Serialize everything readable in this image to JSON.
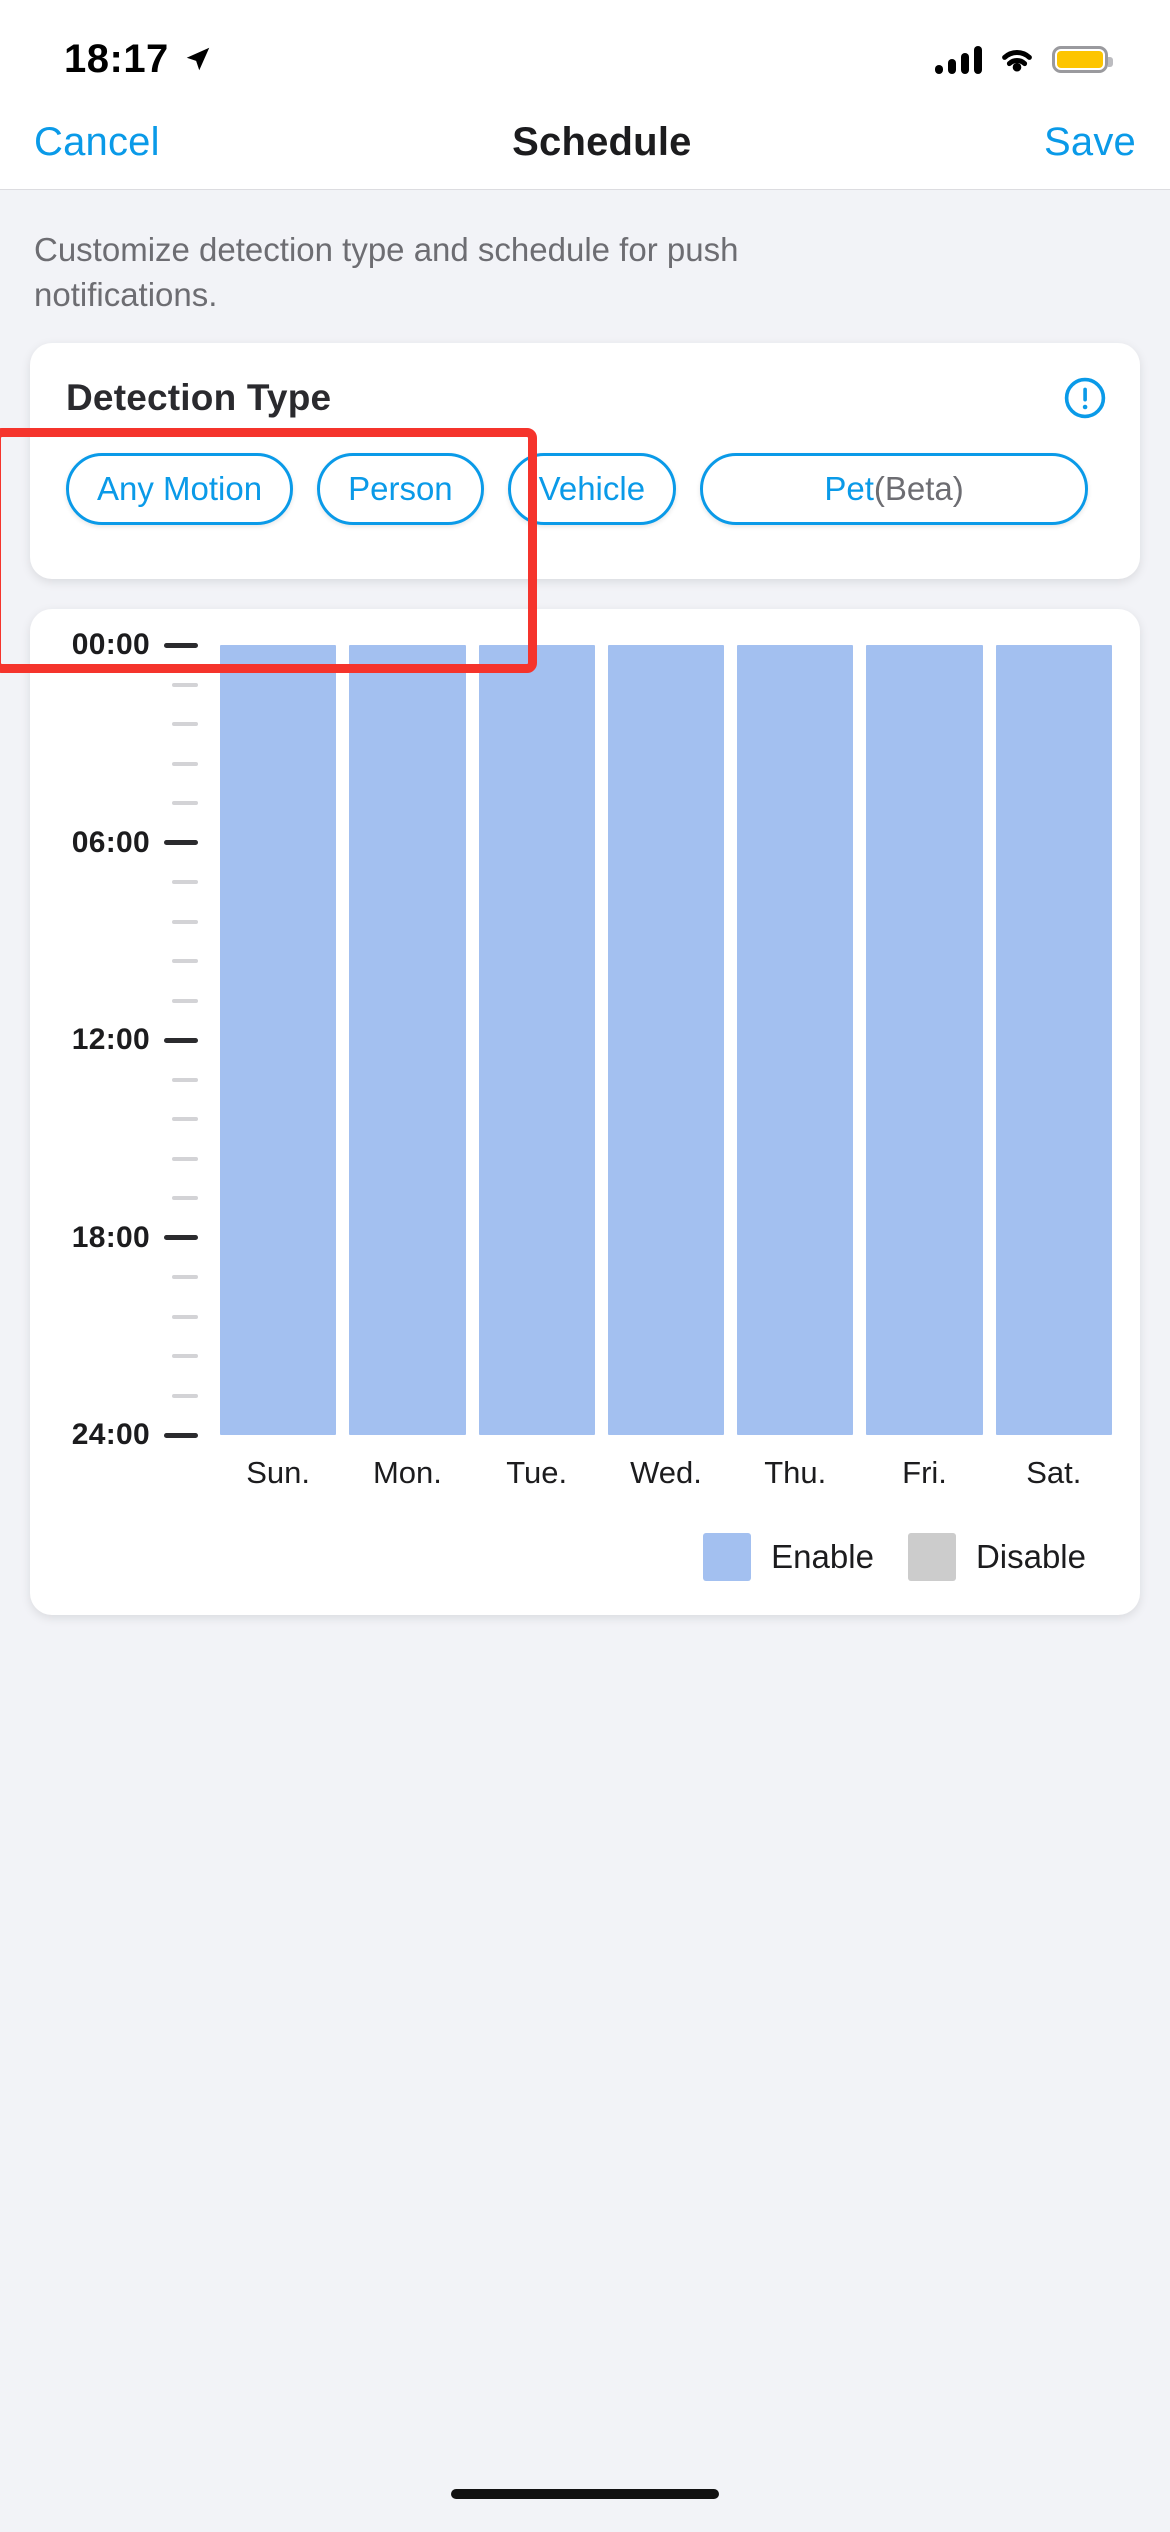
{
  "status_bar": {
    "time": "18:17",
    "location_icon": "location-arrow-icon",
    "signal_icon": "cellular-signal-icon",
    "wifi_icon": "wifi-icon",
    "battery_icon": "battery-icon",
    "battery_color": "#fdc500"
  },
  "nav": {
    "cancel_label": "Cancel",
    "title": "Schedule",
    "save_label": "Save",
    "accent_color": "#0a9ae8"
  },
  "description": "Customize detection type and schedule for push notifications.",
  "detection": {
    "title": "Detection Type",
    "info_icon": "info-exclamation-circle-icon",
    "info_color": "#0a9ae8",
    "chips": [
      {
        "label": "Any Motion",
        "suffix": ""
      },
      {
        "label": "Person",
        "suffix": ""
      },
      {
        "label": "Vehicle",
        "suffix": ""
      },
      {
        "label": "Pet",
        "suffix": "(Beta)"
      }
    ],
    "highlight_color": "#f5342c"
  },
  "chart_data": {
    "type": "bar",
    "title": "",
    "xlabel": "",
    "ylabel": "",
    "categories": [
      "Sun.",
      "Mon.",
      "Tue.",
      "Wed.",
      "Thu.",
      "Fri.",
      "Sat."
    ],
    "y_tick_labels": [
      "00:00",
      "06:00",
      "12:00",
      "18:00",
      "24:00"
    ],
    "y_tick_values": [
      0,
      6,
      12,
      18,
      24
    ],
    "ylim": [
      0,
      24
    ],
    "y_axis_inverted": true,
    "minor_ticks_per_interval": 5,
    "grid": false,
    "legend_position": "bottom-right",
    "series": [
      {
        "name": "Enable",
        "color": "#a3c0f0",
        "values": [
          {
            "day": "Sun.",
            "start": "00:00",
            "end": "24:00"
          },
          {
            "day": "Mon.",
            "start": "00:00",
            "end": "24:00"
          },
          {
            "day": "Tue.",
            "start": "00:00",
            "end": "24:00"
          },
          {
            "day": "Wed.",
            "start": "00:00",
            "end": "24:00"
          },
          {
            "day": "Thu.",
            "start": "00:00",
            "end": "24:00"
          },
          {
            "day": "Fri.",
            "start": "00:00",
            "end": "24:00"
          },
          {
            "day": "Sat.",
            "start": "00:00",
            "end": "24:00"
          }
        ]
      }
    ],
    "legend": [
      {
        "label": "Enable",
        "color": "#a3c0f0"
      },
      {
        "label": "Disable",
        "color": "#cccccc"
      }
    ]
  }
}
